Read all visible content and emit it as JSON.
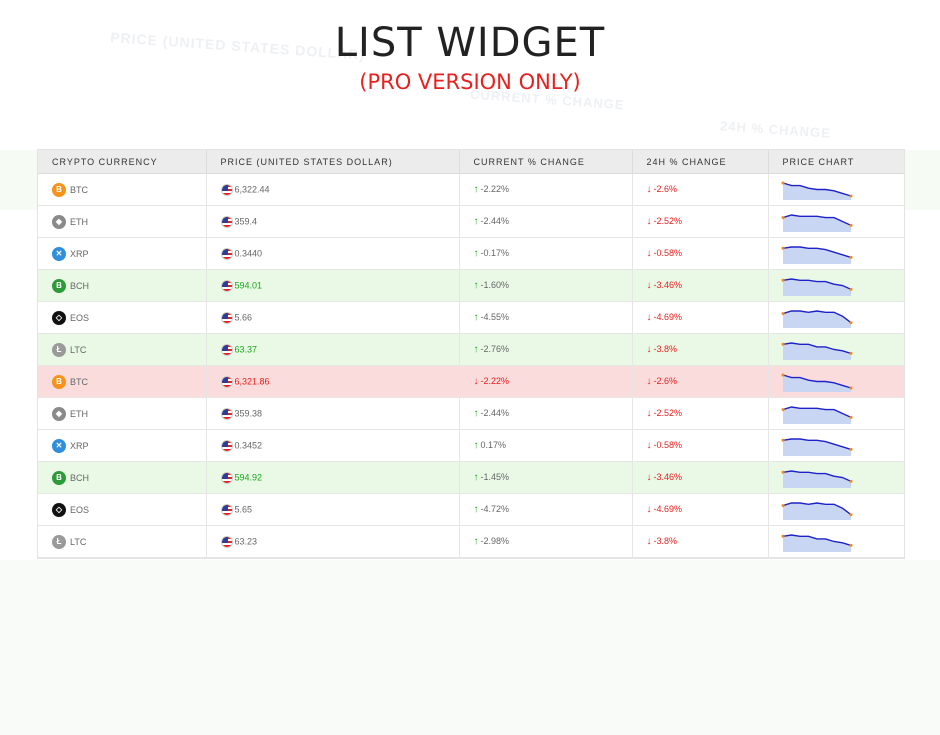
{
  "header": {
    "title": "LIST WIDGET",
    "subtitle": "(PRO VERSION ONLY)"
  },
  "colors": {
    "up": "#1aa81a",
    "down": "#e8201e",
    "chart_line": "#1e22c8",
    "chart_fill": "#c9d6f3",
    "chart_dot": "#f08a1a"
  },
  "table": {
    "columns": [
      "CRYPTO CURRENCY",
      "PRICE (UNITED STATES DOLLAR)",
      "CURRENT % CHANGE",
      "24H % CHANGE",
      "PRICE CHART"
    ],
    "rows": [
      {
        "symbol": "BTC",
        "icon": "bitcoin-icon",
        "icon_color": "#f7931a",
        "icon_glyph": "B",
        "price": "6,322.44",
        "current": "-2.22%",
        "current_dir": "up",
        "h24": "-2.6%",
        "h24_dir": "down",
        "highlight": "none",
        "spark": [
          10,
          8,
          8,
          6,
          5,
          5,
          4,
          2,
          0
        ]
      },
      {
        "symbol": "ETH",
        "icon": "ethereum-icon",
        "icon_color": "#8a8a8a",
        "icon_glyph": "◆",
        "price": "359.4",
        "current": "-2.44%",
        "current_dir": "up",
        "h24": "-2.52%",
        "h24_dir": "down",
        "highlight": "none",
        "spark": [
          8,
          10,
          9,
          9,
          9,
          8,
          8,
          5,
          2
        ]
      },
      {
        "symbol": "XRP",
        "icon": "ripple-icon",
        "icon_color": "#2f8fdd",
        "icon_glyph": "✕",
        "price": "0.3440",
        "current": "-0.17%",
        "current_dir": "up",
        "h24": "-0.58%",
        "h24_dir": "down",
        "highlight": "none",
        "spark": [
          9,
          10,
          10,
          9,
          9,
          8,
          6,
          4,
          2
        ]
      },
      {
        "symbol": "BCH",
        "icon": "bitcoin-cash-icon",
        "icon_color": "#2e9a3a",
        "icon_glyph": "B",
        "price": "594.01",
        "current": "-1.60%",
        "current_dir": "up",
        "h24": "-3.46%",
        "h24_dir": "down",
        "highlight": "up",
        "spark": [
          9,
          10,
          9,
          9,
          8,
          8,
          6,
          5,
          2
        ]
      },
      {
        "symbol": "EOS",
        "icon": "eos-icon",
        "icon_color": "#111111",
        "icon_glyph": "◇",
        "price": "5.66",
        "current": "-4.55%",
        "current_dir": "up",
        "h24": "-4.69%",
        "h24_dir": "down",
        "highlight": "none",
        "spark": [
          8,
          10,
          10,
          9,
          10,
          9,
          9,
          6,
          1
        ]
      },
      {
        "symbol": "LTC",
        "icon": "litecoin-icon",
        "icon_color": "#9a9a9a",
        "icon_glyph": "Ł",
        "price": "63.37",
        "current": "-2.76%",
        "current_dir": "up",
        "h24": "-3.8%",
        "h24_dir": "down",
        "highlight": "up",
        "spark": [
          9,
          10,
          9,
          9,
          7,
          7,
          5,
          4,
          2
        ]
      },
      {
        "symbol": "BTC",
        "icon": "bitcoin-icon",
        "icon_color": "#f7931a",
        "icon_glyph": "B",
        "price": "6,321.86",
        "current": "-2.22%",
        "current_dir": "down",
        "h24": "-2.6%",
        "h24_dir": "down",
        "highlight": "down",
        "spark": [
          10,
          8,
          8,
          6,
          5,
          5,
          4,
          2,
          0
        ]
      },
      {
        "symbol": "ETH",
        "icon": "ethereum-icon",
        "icon_color": "#8a8a8a",
        "icon_glyph": "◆",
        "price": "359.38",
        "current": "-2.44%",
        "current_dir": "up",
        "h24": "-2.52%",
        "h24_dir": "down",
        "highlight": "none",
        "spark": [
          8,
          10,
          9,
          9,
          9,
          8,
          8,
          5,
          2
        ]
      },
      {
        "symbol": "XRP",
        "icon": "ripple-icon",
        "icon_color": "#2f8fdd",
        "icon_glyph": "✕",
        "price": "0.3452",
        "current": "0.17%",
        "current_dir": "up",
        "h24": "-0.58%",
        "h24_dir": "down",
        "highlight": "none",
        "spark": [
          9,
          10,
          10,
          9,
          9,
          8,
          6,
          4,
          2
        ]
      },
      {
        "symbol": "BCH",
        "icon": "bitcoin-cash-icon",
        "icon_color": "#2e9a3a",
        "icon_glyph": "B",
        "price": "594.92",
        "current": "-1.45%",
        "current_dir": "up",
        "h24": "-3.46%",
        "h24_dir": "down",
        "highlight": "up",
        "spark": [
          9,
          10,
          9,
          9,
          8,
          8,
          6,
          5,
          2
        ]
      },
      {
        "symbol": "EOS",
        "icon": "eos-icon",
        "icon_color": "#111111",
        "icon_glyph": "◇",
        "price": "5.65",
        "current": "-4.72%",
        "current_dir": "up",
        "h24": "-4.69%",
        "h24_dir": "down",
        "highlight": "none",
        "spark": [
          8,
          10,
          10,
          9,
          10,
          9,
          9,
          6,
          1
        ]
      },
      {
        "symbol": "LTC",
        "icon": "litecoin-icon",
        "icon_color": "#9a9a9a",
        "icon_glyph": "Ł",
        "price": "63.23",
        "current": "-2.98%",
        "current_dir": "up",
        "h24": "-3.8%",
        "h24_dir": "down",
        "highlight": "none",
        "spark": [
          9,
          10,
          9,
          9,
          7,
          7,
          5,
          4,
          2
        ]
      }
    ]
  }
}
